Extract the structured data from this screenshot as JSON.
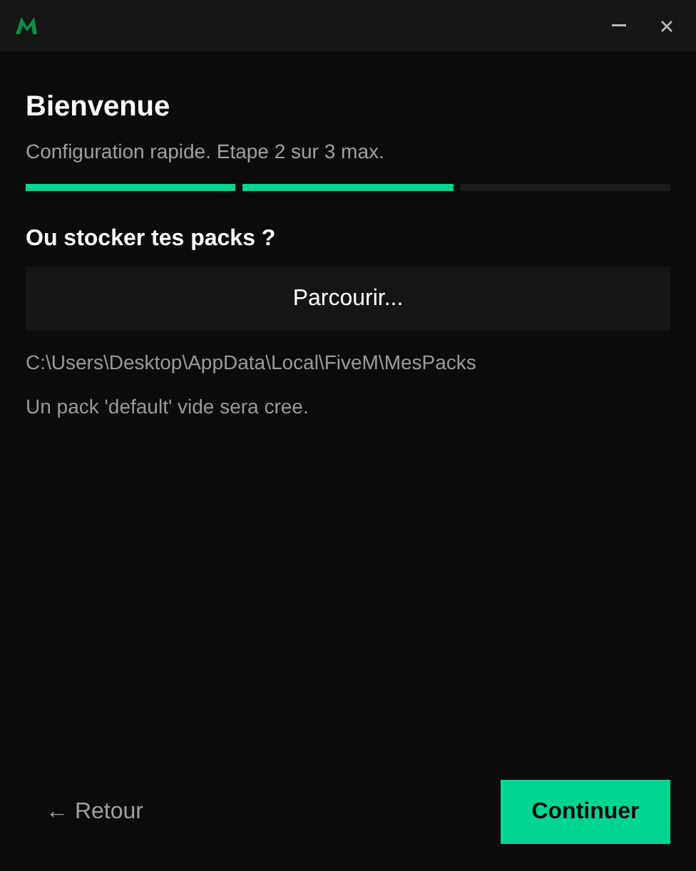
{
  "title": "Bienvenue",
  "subtitle": "Configuration rapide. Etape 2 sur 3 max.",
  "steps": [
    {
      "done": true
    },
    {
      "done": true
    },
    {
      "done": false
    }
  ],
  "question": "Ou stocker tes packs ?",
  "browse_button": "Parcourir...",
  "path": "C:\\Users\\Desktop\\AppData\\Local\\FiveM\\MesPacks",
  "note": "Un pack 'default' vide sera cree.",
  "back_button": "← Retour",
  "continue_button": "Continuer"
}
